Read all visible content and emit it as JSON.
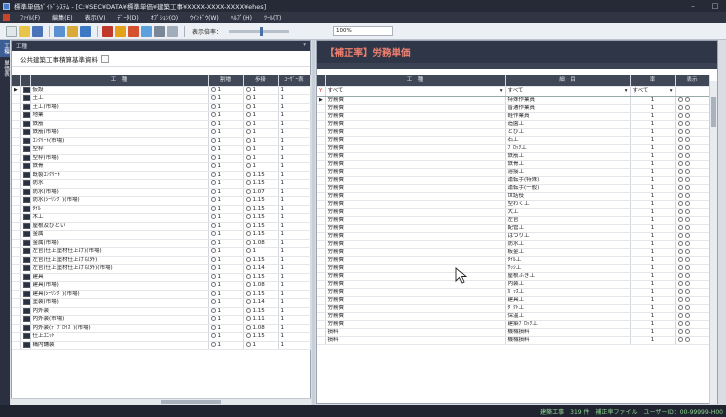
{
  "window": {
    "title": "標準単価ｶﾞｲﾄﾞｼｽﾃﾑ - [C:¥SEC¥DATA¥標準単価¥建築工事¥XXXX-XXXX-XXXX¥ehes]"
  },
  "menu": [
    "ﾌｧｲﾙ(F)",
    "編集(E)",
    "表示(V)",
    "ﾃﾞｰﾀ(D)",
    "ｵﾌﾟｼｮﾝ(O)",
    "ｳｲﾝﾄﾞｳ(W)",
    "ﾍﾙﾌﾟ(H)",
    "ﾂｰﾙ(T)"
  ],
  "toolbar": {
    "zoom_label": "表示倍率：",
    "zoom_value": "100%",
    "zoom_level": 0.55
  },
  "vtabs": [
    "工種",
    "単価表"
  ],
  "left": {
    "header": "工種",
    "label": "公共建築工事積算基準資料",
    "columns": [
      "工　種",
      "割増",
      "歩掛",
      "ﾕｰｻﾞｰ表"
    ],
    "rows": [
      [
        "仮設",
        "1",
        "1",
        "1"
      ],
      [
        "土工",
        "1",
        "1",
        "1"
      ],
      [
        "土工(市場)",
        "1",
        "1",
        "1"
      ],
      [
        "地業",
        "1",
        "1",
        "1"
      ],
      [
        "鉄筋",
        "1",
        "1",
        "1"
      ],
      [
        "鉄筋(市場)",
        "1",
        "1",
        "1"
      ],
      [
        "ｺﾝｸﾘｰﾄ(市場)",
        "1",
        "1",
        "1"
      ],
      [
        "型枠",
        "1",
        "1",
        "1"
      ],
      [
        "型枠(市場)",
        "1",
        "1",
        "1"
      ],
      [
        "鉄骨",
        "1",
        "1",
        "1"
      ],
      [
        "既製ｺﾝｸﾘｰﾄ",
        "1",
        "1.15",
        "1"
      ],
      [
        "防水",
        "1",
        "1.15",
        "1"
      ],
      [
        "防水(市場)",
        "1",
        "1.07",
        "1"
      ],
      [
        "防水(ｼｰﾘﾝｸﾞ)(市場)",
        "1",
        "1.15",
        "1"
      ],
      [
        "ﾀｲﾙ",
        "1",
        "1.15",
        "1"
      ],
      [
        "木工",
        "1",
        "1.15",
        "1"
      ],
      [
        "屋根及びとい",
        "1",
        "1.15",
        "1"
      ],
      [
        "金属",
        "1",
        "1.15",
        "1"
      ],
      [
        "金属(市場)",
        "1",
        "1.08",
        "1"
      ],
      [
        "左官(仕上塗材仕上げ)(市場)",
        "1",
        "1",
        "1"
      ],
      [
        "左官(仕上塗材仕上げ以外)",
        "1",
        "1.15",
        "1"
      ],
      [
        "左官(仕上塗材仕上げ以外)(市場)",
        "1",
        "1.14",
        "1"
      ],
      [
        "建具",
        "1",
        "1.15",
        "1"
      ],
      [
        "建具(市場)",
        "1",
        "1.08",
        "1"
      ],
      [
        "建具(ｼｰﾘﾝｸﾞ)(市場)",
        "1",
        "1.15",
        "1"
      ],
      [
        "塗装(市場)",
        "1",
        "1.14",
        "1"
      ],
      [
        "内外装",
        "1",
        "1.15",
        "1"
      ],
      [
        "内外装(市場)",
        "1",
        "1.11",
        "1"
      ],
      [
        "内外装(ﾃﾞﾌﾟﾛｲｽﾞ)(市場)",
        "1",
        "1.08",
        "1"
      ],
      [
        "仕上ﾕﾆｯﾄ",
        "1",
        "1.15",
        "1"
      ],
      [
        "構内舗装",
        "1",
        "1",
        "1"
      ]
    ]
  },
  "right": {
    "header": "【補正率】労務単価",
    "columns": [
      "工　種",
      "細　目",
      "率",
      "表示"
    ],
    "filter": [
      "すべて",
      "すべて",
      "すべて"
    ],
    "rows": [
      [
        "労務費",
        "特殊作業員",
        "1"
      ],
      [
        "労務費",
        "普通作業員",
        "1"
      ],
      [
        "労務費",
        "軽作業員",
        "1"
      ],
      [
        "労務費",
        "造園工",
        "1"
      ],
      [
        "労務費",
        "とび工",
        "1"
      ],
      [
        "労務費",
        "石工",
        "1"
      ],
      [
        "労務費",
        "ﾌﾞﾛｯｸ工",
        "1"
      ],
      [
        "労務費",
        "鉄筋工",
        "1"
      ],
      [
        "労務費",
        "鉄骨工",
        "1"
      ],
      [
        "労務費",
        "溶接工",
        "1"
      ],
      [
        "労務費",
        "運転手(特殊)",
        "1"
      ],
      [
        "労務費",
        "運転手(一般)",
        "1"
      ],
      [
        "労務費",
        "世話役",
        "1"
      ],
      [
        "労務費",
        "型わく工",
        "1"
      ],
      [
        "労務費",
        "大工",
        "1"
      ],
      [
        "労務費",
        "左官",
        "1"
      ],
      [
        "労務費",
        "配管工",
        "1"
      ],
      [
        "労務費",
        "はつり工",
        "1"
      ],
      [
        "労務費",
        "防水工",
        "1"
      ],
      [
        "労務費",
        "板金工",
        "1"
      ],
      [
        "労務費",
        "ﾀｲﾙ工",
        "1"
      ],
      [
        "労務費",
        "ｻｯｼ工",
        "1"
      ],
      [
        "労務費",
        "屋根ふき工",
        "1"
      ],
      [
        "労務費",
        "内装工",
        "1"
      ],
      [
        "労務費",
        "ｶﾞﾗｽ工",
        "1"
      ],
      [
        "労務費",
        "建具工",
        "1"
      ],
      [
        "労務費",
        "ﾀﾞｸﾄ工",
        "1"
      ],
      [
        "労務費",
        "保温工",
        "1"
      ],
      [
        "労務費",
        "建築ﾌﾞﾛｯｸ工",
        "1"
      ],
      [
        "損料",
        "機械損料",
        "1"
      ],
      [
        "損料",
        "機械損料",
        "1"
      ]
    ]
  },
  "status": "建築工事　319 件　補正率ファイル　ユーザーID：00-99999-H00"
}
